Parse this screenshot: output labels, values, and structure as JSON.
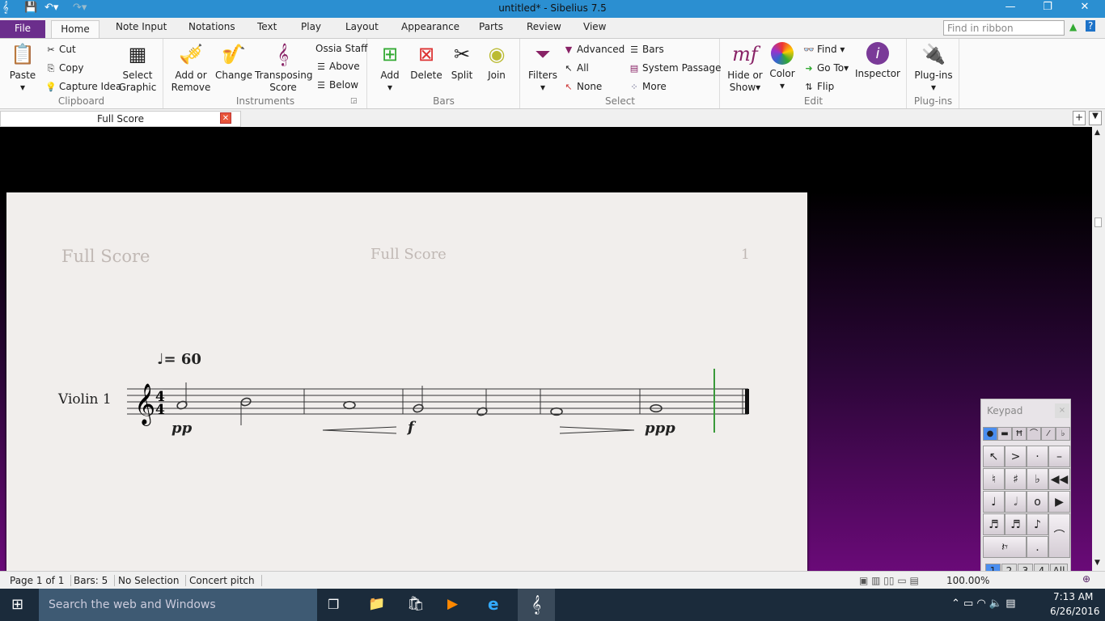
{
  "window": {
    "title": "untitled* - Sibelius 7.5"
  },
  "menu_tabs": [
    "File",
    "Home",
    "Note Input",
    "Notations",
    "Text",
    "Play",
    "Layout",
    "Appearance",
    "Parts",
    "Review",
    "View"
  ],
  "find_placeholder": "Find in ribbon",
  "ribbon": {
    "clipboard": {
      "label": "Clipboard",
      "paste": "Paste",
      "cut": "Cut",
      "copy": "Copy",
      "capture": "Capture Idea",
      "select_graphic": "Select Graphic"
    },
    "instruments": {
      "label": "Instruments",
      "add": "Add or Remove",
      "change": "Change",
      "transposing": "Transposing Score",
      "ossia": "Ossia Staff",
      "above": "Above",
      "below": "Below"
    },
    "bars": {
      "label": "Bars",
      "add": "Add",
      "delete": "Delete",
      "split": "Split",
      "join": "Join"
    },
    "select": {
      "label": "Select",
      "filters": "Filters",
      "advanced": "Advanced",
      "all": "All",
      "none": "None",
      "bars": "Bars",
      "system_passage": "System Passage",
      "more": "More"
    },
    "edit": {
      "label": "Edit",
      "hide": "Hide or Show",
      "color": "Color",
      "find": "Find",
      "goto": "Go To",
      "flip": "Flip",
      "inspector": "Inspector"
    },
    "plugins": {
      "label": "Plug-ins",
      "plugins": "Plug-ins"
    }
  },
  "doc_tab": "Full Score",
  "score": {
    "header_left": "Full Score",
    "header_center": "Full Score",
    "page_number": "1",
    "tempo": "= 60",
    "instrument": "Violin 1",
    "time_signature": "4/4",
    "dynamics": [
      "pp",
      "f",
      "ppp"
    ]
  },
  "keypad": {
    "title": "Keypad",
    "layouts": [
      "1",
      "2",
      "3",
      "4",
      "All"
    ],
    "selected_layout": "1"
  },
  "status": {
    "page": "Page 1 of 1",
    "bars": "Bars: 5",
    "selection": "No Selection",
    "pitch": "Concert pitch",
    "zoom": "100.00%"
  },
  "taskbar": {
    "search": "Search the web and Windows",
    "time": "7:13 AM",
    "date": "6/26/2016"
  },
  "colors": {
    "titlebar": "#2b8fd1",
    "file_tab": "#6b2e8c",
    "playback_line": "#3a9a3a"
  }
}
